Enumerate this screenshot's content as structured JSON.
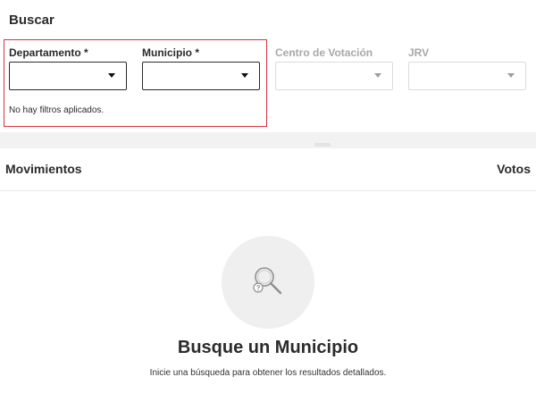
{
  "search": {
    "title": "Buscar",
    "filters": [
      {
        "label": "Departamento *",
        "value": "",
        "enabled": true
      },
      {
        "label": "Municipio *",
        "value": "",
        "enabled": true
      },
      {
        "label": "Centro de Votación",
        "value": "",
        "enabled": false
      },
      {
        "label": "JRV",
        "value": "",
        "enabled": false
      }
    ],
    "status": "No hay filtros aplicados."
  },
  "results": {
    "columns": {
      "left": "Movimientos",
      "right": "Votos"
    },
    "empty_state": {
      "icon": "magnifier-question-icon",
      "title": "Busque un Municipio",
      "subtitle": "Inicie una búsqueda para obtener los resultados detallados."
    }
  },
  "colors": {
    "highlight": "#d9343f",
    "text": "#2b2b2b",
    "disabled_text": "#a8a8a8",
    "empty_icon_bg": "#efefef"
  }
}
